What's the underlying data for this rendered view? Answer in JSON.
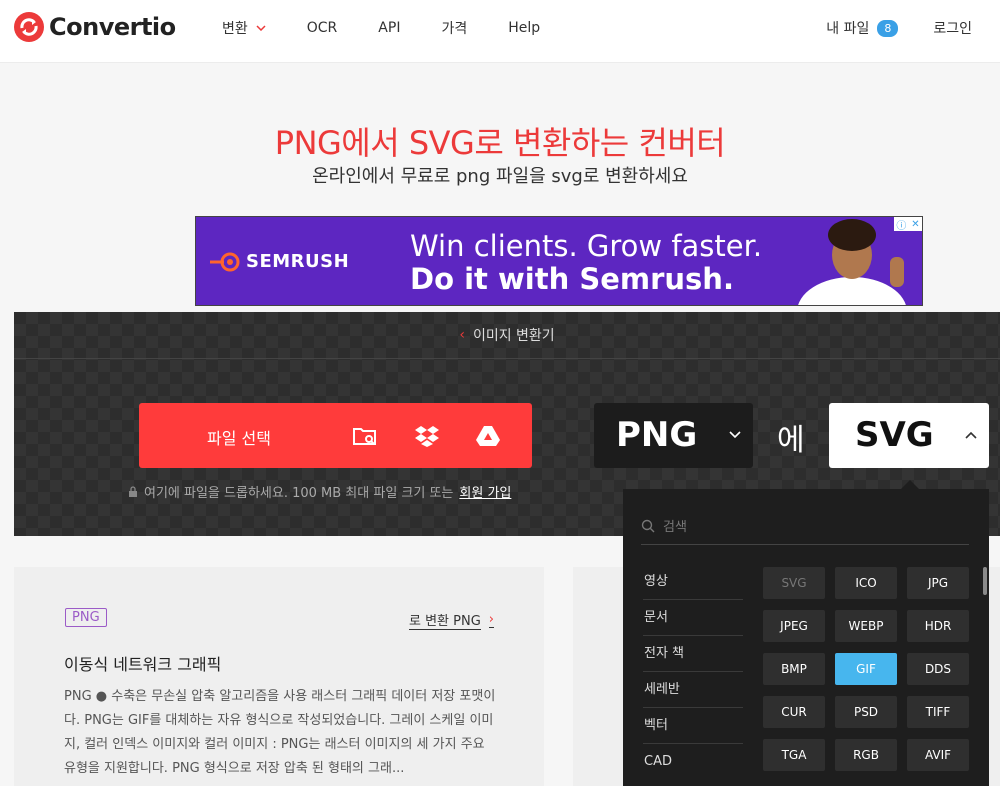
{
  "header": {
    "brand": "Convertio",
    "nav": [
      "변환",
      "OCR",
      "API",
      "가격",
      "Help"
    ],
    "my_files_label": "내 파일",
    "my_files_count": "8",
    "login_label": "로그인"
  },
  "hero": {
    "title": "PNG에서 SVG로 변환하는 컨버터",
    "subtitle": "온라인에서 무료로 png 파일을 svg로 변환하세요"
  },
  "ad": {
    "brand": "SEMRUSH",
    "line1": "Win clients. Grow faster.",
    "line2": "Do it with Semrush.",
    "brand_color": "#5d26c1"
  },
  "converter": {
    "breadcrumb": "이미지 변환기",
    "upload_label": "파일 선택",
    "hint": "여기에 파일을 드롭하세요. 100 MB 최대 파일 크기 또는",
    "signup_label": "회원 가입",
    "from_format": "PNG",
    "to_word": "에",
    "to_format": "SVG",
    "accent": "#ff3b3b"
  },
  "info_card": {
    "tag": "PNG",
    "link": "로 변환 PNG",
    "title": "이동식 네트워크 그래픽",
    "body": "PNG ● 수축은 무손실 압축 알고리즘을 사용 래스터 그래픽 데이터 저장 포맷이다. PNG는 GIF를 대체하는 자유 형식으로 작성되었습니다. 그레이 스케일 이미지, 컬러 인덱스 이미지와 컬러 이미지 : PNG는 래스터 이미지의 세 가지 주요 유형을 지원합니다. PNG 형식으로 저장 압축 된 형태의 그래..."
  },
  "dropdown": {
    "search_placeholder": "검색",
    "categories": [
      "영상",
      "문서",
      "전자 책",
      "세레반",
      "벡터",
      "CAD"
    ],
    "formats": [
      "SVG",
      "ICO",
      "JPG",
      "JPEG",
      "WEBP",
      "HDR",
      "BMP",
      "GIF",
      "DDS",
      "CUR",
      "PSD",
      "TIFF",
      "TGA",
      "RGB",
      "AVIF"
    ],
    "selected": "GIF",
    "disabled": "SVG",
    "selected_color": "#47b6ee"
  }
}
